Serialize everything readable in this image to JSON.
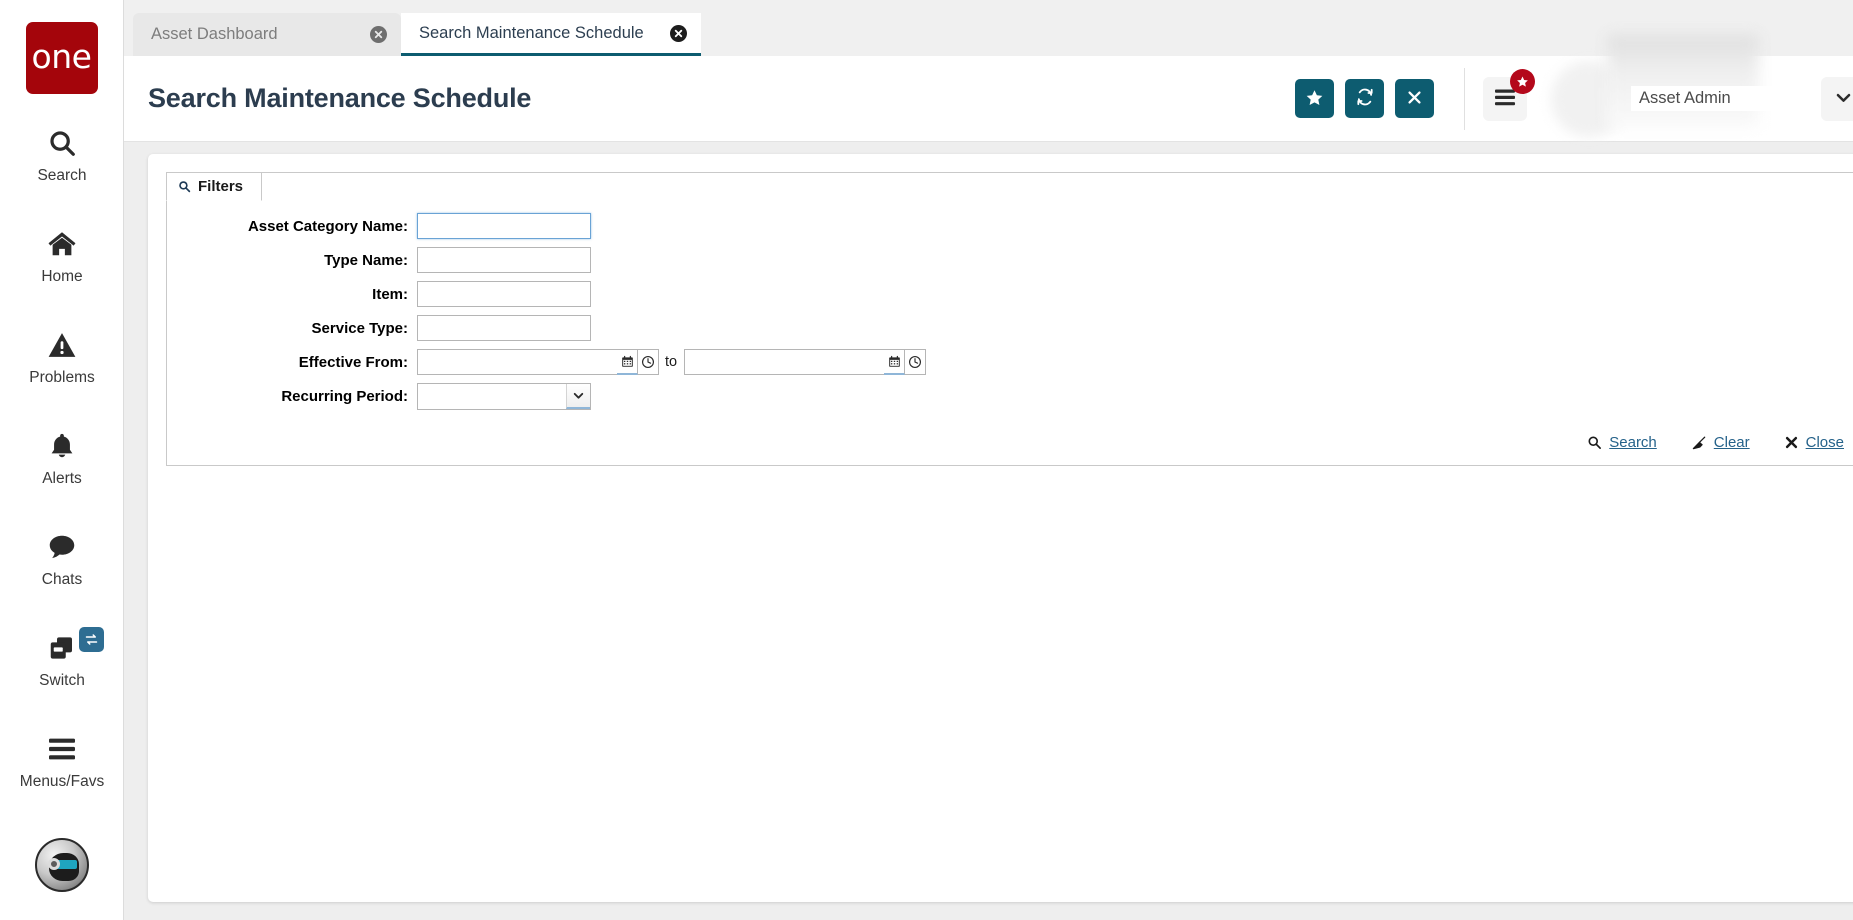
{
  "brand": {
    "logo_text": "one",
    "logo_bg": "#a4050b"
  },
  "sidebar": {
    "items": [
      {
        "label": "Search",
        "icon": "search-icon"
      },
      {
        "label": "Home",
        "icon": "home-icon"
      },
      {
        "label": "Problems",
        "icon": "warning-triangle-icon"
      },
      {
        "label": "Alerts",
        "icon": "bell-icon"
      },
      {
        "label": "Chats",
        "icon": "chat-bubble-icon"
      },
      {
        "label": "Switch",
        "icon": "windows-switch-icon",
        "badge_icon": "swap-arrows-icon"
      },
      {
        "label": "Menus/Favs",
        "icon": "hamburger-icon"
      }
    ],
    "assistant": {
      "name": "ai-assistant-orb"
    }
  },
  "tabs": [
    {
      "label": "Asset Dashboard",
      "active": false,
      "close_icon": "close-circle-icon"
    },
    {
      "label": "Search Maintenance Schedule",
      "active": true,
      "close_icon": "close-circle-icon"
    }
  ],
  "header": {
    "title": "Search Maintenance Schedule",
    "accent": "#0d5c70",
    "actions": [
      {
        "name": "favorite-button",
        "icon": "star-icon",
        "label": "Favorite"
      },
      {
        "name": "refresh-button",
        "icon": "refresh-icon",
        "label": "Refresh"
      },
      {
        "name": "close-button",
        "icon": "x-icon",
        "label": "Close"
      }
    ],
    "menus_button": {
      "icon": "hamburger-icon",
      "badge_icon": "star-icon",
      "badge_color": "#b4081b"
    },
    "user": {
      "name": "Asset Admin",
      "caret_icon": "chevron-down-icon"
    }
  },
  "filters": {
    "panel_title": "Filters",
    "panel_icon": "search-icon",
    "fields": [
      {
        "label": "Asset Category Name:",
        "type": "text",
        "value": "",
        "focused": true
      },
      {
        "label": "Type Name:",
        "type": "text",
        "value": "",
        "focused": false
      },
      {
        "label": "Item:",
        "type": "text",
        "value": "",
        "focused": false
      },
      {
        "label": "Service Type:",
        "type": "text",
        "value": "",
        "focused": false
      }
    ],
    "date_range": {
      "label": "Effective From:",
      "from_value": "",
      "to_value": "",
      "separator": "to",
      "calendar_icon": "calendar-icon",
      "clock_icon": "clock-icon"
    },
    "recurring": {
      "label": "Recurring Period:",
      "selected": "",
      "options": [
        ""
      ],
      "caret_icon": "chevron-down-icon"
    },
    "actions": [
      {
        "name": "search-link",
        "label": "Search",
        "icon": "search-icon"
      },
      {
        "name": "clear-link",
        "label": "Clear",
        "icon": "broom-icon"
      },
      {
        "name": "close-link",
        "label": "Close",
        "icon": "x-icon"
      }
    ]
  }
}
